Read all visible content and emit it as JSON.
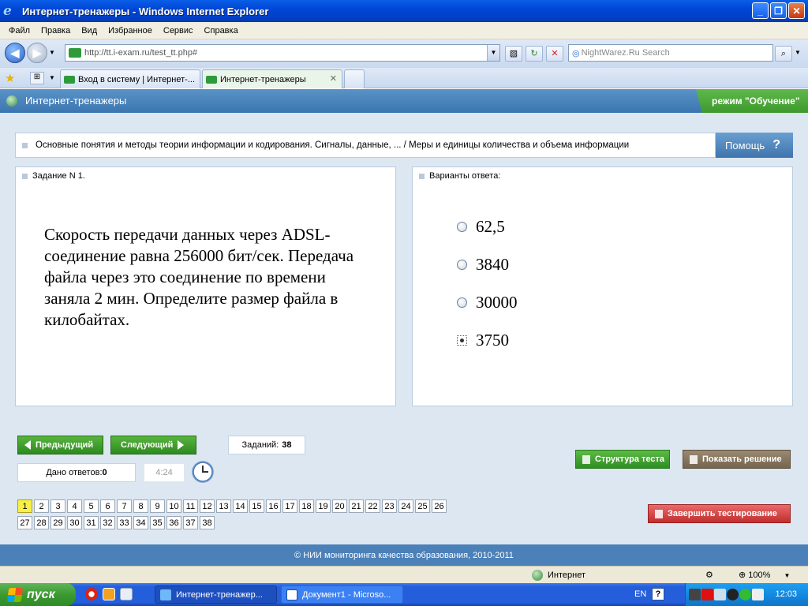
{
  "window": {
    "title": "Интернет-тренажеры - Windows Internet Explorer"
  },
  "menu": [
    "Файл",
    "Правка",
    "Вид",
    "Избранное",
    "Сервис",
    "Справка"
  ],
  "address": {
    "url": "http://tt.i-exam.ru/test_tt.php#",
    "search_placeholder": "NightWarez.Ru Search"
  },
  "tabs": [
    {
      "label": "Вход в систему | Интернет-...",
      "active": false
    },
    {
      "label": "Интернет-тренажеры",
      "active": true
    }
  ],
  "page": {
    "site_title": "Интернет-тренажеры",
    "mode": "режим \"Обучение\"",
    "topic": "Основные понятия и методы теории информации и кодирования. Сигналы, данные, ... / Меры и единицы количества и объема информации",
    "help_label": "Помощь",
    "help_icon": "?",
    "task_header": "Задание N 1.",
    "question": "Скорость передачи данных через ADSL-соединение равна 256000 бит/сек. Передача файла через это соединение по времени заняла 2 мин. Определите размер файла в килобайтах.",
    "answers_header": "Варианты ответа:",
    "answers": [
      {
        "text": "62,5",
        "selected": false
      },
      {
        "text": "3840",
        "selected": false
      },
      {
        "text": "30000",
        "selected": false
      },
      {
        "text": "3750",
        "selected": true
      }
    ],
    "prev_label": "Предыдущий",
    "next_label": "Следующий",
    "tasks_label": "Заданий:",
    "tasks_count": "38",
    "answered_label": "Дано ответов:",
    "answered_count": "0",
    "timer": "4:24",
    "structure_label": "Структура теста",
    "solution_label": "Показать решение",
    "finish_label": "Завершить тестирование",
    "task_numbers": [
      "1",
      "2",
      "3",
      "4",
      "5",
      "6",
      "7",
      "8",
      "9",
      "10",
      "11",
      "12",
      "13",
      "14",
      "15",
      "16",
      "17",
      "18",
      "19",
      "20",
      "21",
      "22",
      "23",
      "24",
      "25",
      "26",
      "27",
      "28",
      "29",
      "30",
      "31",
      "32",
      "33",
      "34",
      "35",
      "36",
      "37",
      "38"
    ],
    "current_task": "1",
    "footer": "© НИИ мониторинга качества образования, 2010-2011"
  },
  "status": {
    "zone": "Интернет",
    "zoom": "100%"
  },
  "taskbar": {
    "start_label": "пуск",
    "tasks": [
      {
        "label": "Интернет-тренажер...",
        "active": true
      },
      {
        "label": "Документ1 - Microso...",
        "active": false
      }
    ],
    "lang": "EN",
    "help": "?",
    "clock": "12:03"
  },
  "colors": {
    "title_bar": "#0046d6",
    "page_header": "#4a84bc",
    "mode_badge": "#4ea83a",
    "content_bg": "#dce7f2",
    "green_button": "#3f9e2c",
    "brown_button": "#85745d",
    "red_button": "#d64545",
    "current_task": "#f7f04a"
  }
}
